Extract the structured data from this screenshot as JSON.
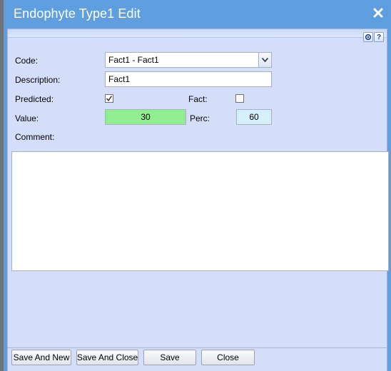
{
  "dialog": {
    "title": "Endophyte Type1 Edit"
  },
  "toolbar": {
    "icons": [
      "refresh-icon",
      "help-icon"
    ],
    "help_glyph": "?"
  },
  "form": {
    "code_label": "Code:",
    "code_value": "Fact1 - Fact1",
    "description_label": "Description:",
    "description_value": "Fact1",
    "predicted_label": "Predicted:",
    "predicted_checked": true,
    "fact_label": "Fact:",
    "fact_checked": false,
    "value_label": "Value:",
    "value_value": "30",
    "perc_label": "Perc:",
    "perc_value": "60",
    "comment_label": "Comment:",
    "comment_value": ""
  },
  "buttons": {
    "save_and_new": "Save And New",
    "save_and_close": "Save And Close",
    "save": "Save",
    "close": "Close"
  },
  "colors": {
    "titlebar": "#5f9fe0",
    "panel": "#d5def9",
    "value_field": "#90ee90",
    "perc_field": "#d6f0fb"
  }
}
